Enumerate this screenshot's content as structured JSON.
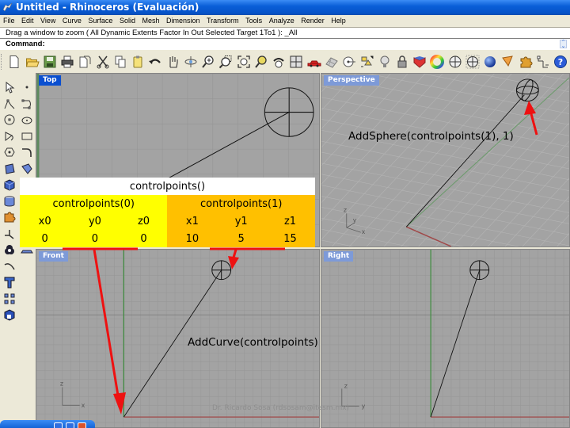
{
  "window": {
    "title": "Untitled - Rhinoceros (Evaluación)"
  },
  "menu": [
    "File",
    "Edit",
    "View",
    "Curve",
    "Surface",
    "Solid",
    "Mesh",
    "Dimension",
    "Transform",
    "Tools",
    "Analyze",
    "Render",
    "Help"
  ],
  "command": {
    "history": "Drag a window to zoom ( All  Dynamic  Extents  Factor  In  Out  Selected  Target  1To1 ): _All",
    "prompt": "Command:",
    "input_value": ""
  },
  "toolbar": {
    "icons": [
      "new-file-icon",
      "open-folder-icon",
      "save-icon",
      "print-icon",
      "import-icon",
      "cut-icon",
      "copy-icon",
      "paste-icon",
      "undo-icon",
      "pan-hand-icon",
      "rotate-view-icon",
      "zoom-dynamic-icon",
      "zoom-window-icon",
      "zoom-extents-icon",
      "zoom-selected-icon",
      "undo-view-icon",
      "four-viewports-icon",
      "car-icon",
      "grid-options-icon",
      "object-snap-icon",
      "layers-icon",
      "light-bulb-icon",
      "lock-icon",
      "shaded-icon",
      "color-wheel-icon",
      "wireframe-sphere-icon",
      "render-sphere-icon",
      "rendered-sphere-icon",
      "analysis-icon",
      "puzzle-icon",
      "grid-snap-icon",
      "help-icon"
    ]
  },
  "left_toolbar": {
    "col1": [
      "select-arrow-icon",
      "polyline-icon",
      "circle-icon",
      "arc-icon",
      "polygon-icon",
      "surface-icon",
      "box-solid-icon",
      "cylinder-icon",
      "puzzle-piece-icon",
      "transform-icon",
      "boolean-icon",
      "fillet-icon",
      "text-icon",
      "array-icon",
      "solid-block-icon"
    ],
    "col2": [
      "point-icon",
      "curve-icon",
      "ellipse-icon",
      "rectangle-icon",
      "fillet-curve-icon",
      "revolve-icon",
      "group-icon",
      "curve-offset-icon",
      "dimension-icon",
      "project-icon",
      "layout-icon"
    ]
  },
  "viewports": {
    "top": {
      "label": "Top",
      "active": true
    },
    "perspective": {
      "label": "Perspective",
      "active": false
    },
    "front": {
      "label": "Front",
      "active": false
    },
    "right": {
      "label": "Right",
      "active": false
    }
  },
  "axis_labels": {
    "perspective": [
      "z",
      "y",
      "x"
    ],
    "front": [
      "z",
      "x"
    ],
    "right": [
      "z",
      "y"
    ]
  },
  "table": {
    "title": "controlpoints()",
    "groups": [
      {
        "label": "controlpoints(0)",
        "color": "#ffff00",
        "headers": [
          "x0",
          "y0",
          "z0"
        ],
        "values": [
          "0",
          "0",
          "0"
        ]
      },
      {
        "label": "controlpoints(1)",
        "color": "#ffc000",
        "headers": [
          "x1",
          "y1",
          "z1"
        ],
        "values": [
          "10",
          "5",
          "15"
        ]
      }
    ]
  },
  "annotations": {
    "sphere": "AddSphere(controlpoints(1), 1)",
    "curve": "AddCurve(controlpoints)"
  },
  "watermark": "Dr. Ricardo Sosa (rdsosam@itesm.mx)",
  "colors": {
    "title_bar": "#0a5fd8",
    "viewport_bg": "#a3a3a3",
    "active_label": "#0a4fd0",
    "inactive_label": "#7d9ad8",
    "arrow_red": "#ee1111",
    "axis_green": "#3c8c3c",
    "axis_red": "#a04040"
  }
}
